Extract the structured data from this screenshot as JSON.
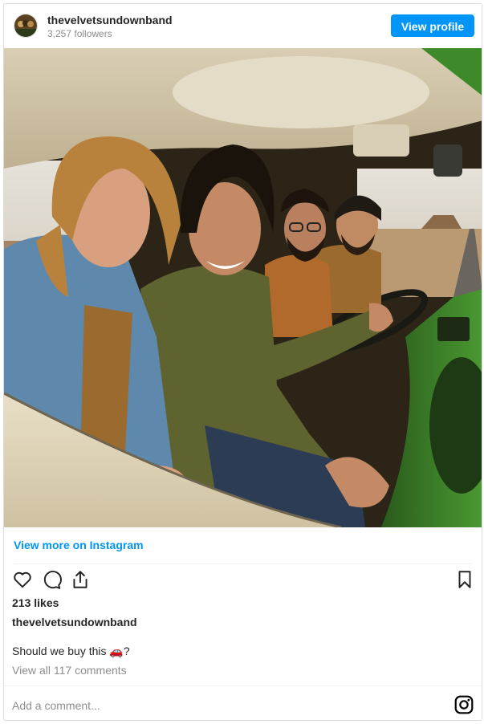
{
  "header": {
    "username": "thevelvetsundownband",
    "followers": "3,257 followers",
    "view_profile_label": "View profile"
  },
  "post": {
    "view_more_label": "View more on Instagram",
    "likes": "213 likes",
    "caption_username": "thevelvetsundownband",
    "caption_text": "Should we buy this 🚗?",
    "comments_link": "View all 117 comments",
    "add_comment_placeholder": "Add a comment..."
  },
  "icons": [
    "heart-icon",
    "comment-icon",
    "share-icon",
    "bookmark-icon",
    "instagram-icon"
  ],
  "colors": {
    "accent": "#0095f6",
    "text": "#262626",
    "muted": "#8e8e8e",
    "van_green": "#3e8a2a"
  }
}
